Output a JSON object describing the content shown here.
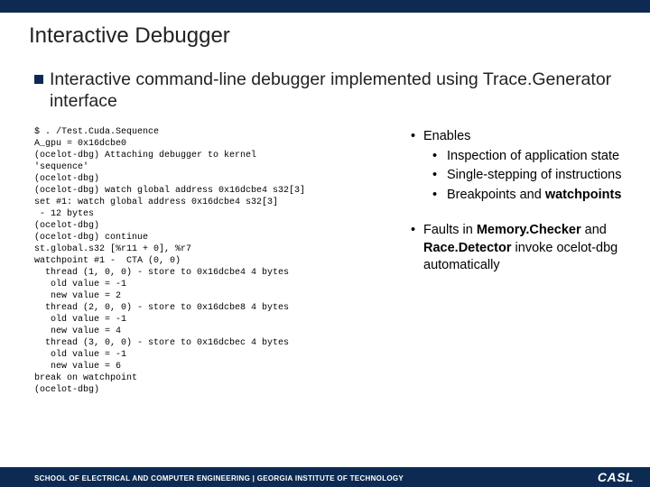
{
  "header": {
    "title": "Interactive Debugger"
  },
  "main_bullet": "Interactive command-line debugger implemented using Trace.Generator interface",
  "code": "$ . /Test.Cuda.Sequence\nA_gpu = 0x16dcbe0\n(ocelot-dbg) Attaching debugger to kernel\n'sequence'\n(ocelot-dbg)\n(ocelot-dbg) watch global address 0x16dcbe4 s32[3]\nset #1: watch global address 0x16dcbe4 s32[3]\n - 12 bytes\n(ocelot-dbg)\n(ocelot-dbg) continue\nst.global.s32 [%r11 + 0], %r7\nwatchpoint #1 -  CTA (0, 0)\n  thread (1, 0, 0) - store to 0x16dcbe4 4 bytes\n   old value = -1\n   new value = 2\n  thread (2, 0, 0) - store to 0x16dcbe8 4 bytes\n   old value = -1\n   new value = 4\n  thread (3, 0, 0) - store to 0x16dcbec 4 bytes\n   old value = -1\n   new value = 6\nbreak on watchpoint\n(ocelot-dbg)",
  "right": {
    "enables_label": "Enables",
    "sub1": "Inspection of application state",
    "sub2": "Single-stepping of instructions",
    "sub3_a": "Breakpoints and ",
    "sub3_b": "watchpoints",
    "faults_a": "Faults in ",
    "faults_b": "Memory.Checker",
    "faults_c": " and ",
    "faults_d": "Race.Detector",
    "faults_e": " invoke ocelot-dbg automatically"
  },
  "footer": {
    "text": "SCHOOL OF ELECTRICAL AND COMPUTER ENGINEERING | GEORGIA INSTITUTE OF TECHNOLOGY",
    "logo": "CASL"
  }
}
